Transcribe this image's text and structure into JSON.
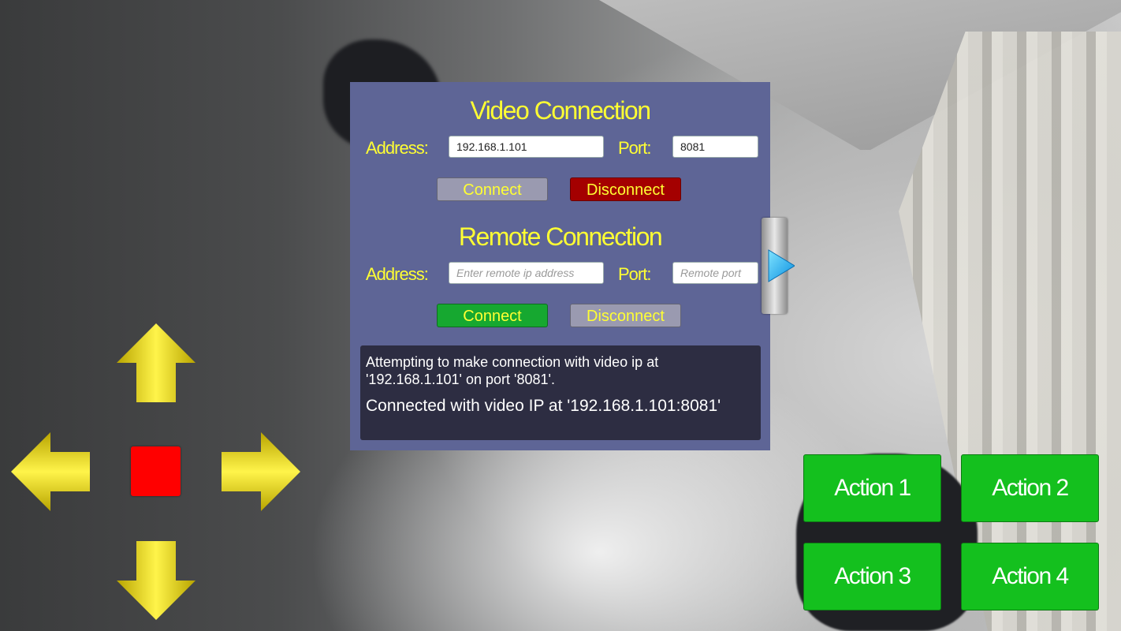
{
  "video": {
    "title": "Video Connection",
    "address_label": "Address:",
    "address_value": "192.168.1.101",
    "port_label": "Port:",
    "port_value": "8081",
    "connect_label": "Connect",
    "disconnect_label": "Disconnect"
  },
  "remote": {
    "title": "Remote Connection",
    "address_label": "Address:",
    "address_placeholder": "Enter remote ip address",
    "port_label": "Port:",
    "port_placeholder": "Remote port",
    "connect_label": "Connect",
    "disconnect_label": "Disconnect"
  },
  "log": {
    "line1": "Attempting to make connection with video ip at '192.168.1.101' on port '8081'.",
    "line2": "Connected with video IP at '192.168.1.101:8081'"
  },
  "actions": [
    "Action 1",
    "Action 2",
    "Action 3",
    "Action 4"
  ],
  "colors": {
    "panel": "#5e6596",
    "label_yellow": "#ffff33",
    "action_green": "#14c01e",
    "stop_red": "#ff0000"
  },
  "icons": {
    "panel_toggle": "play-right-icon",
    "dpad": [
      "arrow-up-icon",
      "arrow-left-icon",
      "arrow-right-icon",
      "arrow-down-icon",
      "stop-square-icon"
    ]
  }
}
